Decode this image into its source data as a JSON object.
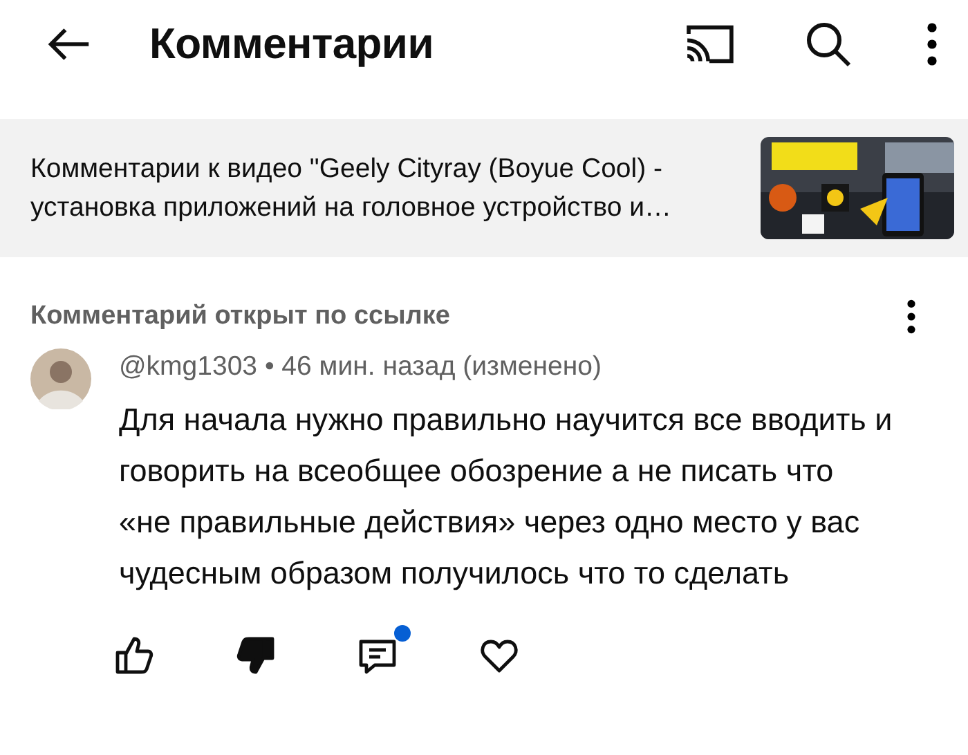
{
  "header": {
    "title": "Комментарии"
  },
  "video": {
    "caption": "Комментарии к видео \"Geely Cityray (Boyue Cool) - установка приложений на головное устройство и…"
  },
  "section_label": "Комментарий открыт по ссылке",
  "comment": {
    "author": "@kmg1303",
    "meta": "• 46 мин. назад (изменено)",
    "text": "Для начала нужно правильно научится все вводить и говорить на всеобщее обозрение а не писать что «не правильные действия» через одно место у вас чудесным образом получилось что то сделать",
    "actions": [
      {
        "kind": "like",
        "selected": false
      },
      {
        "kind": "dislike",
        "selected": true
      },
      {
        "kind": "reply",
        "dot": true
      },
      {
        "kind": "heart",
        "selected": false
      }
    ]
  }
}
